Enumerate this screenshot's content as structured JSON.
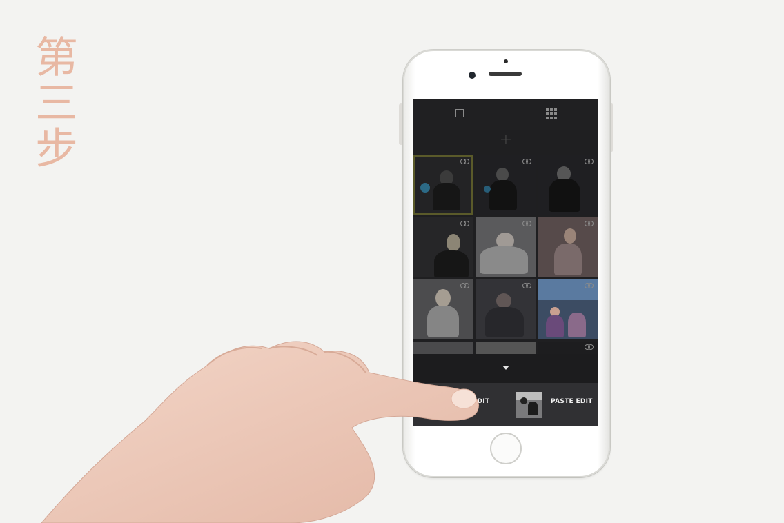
{
  "overlay_text": "第三步",
  "app": {
    "view_toggle": {
      "single_icon": "square-icon",
      "grid_icon": "grid-icon"
    },
    "add_icon_glyph": "+",
    "tiles": [
      {
        "badge": "linked-rings-icon",
        "selected": true
      },
      {
        "badge": "linked-rings-icon"
      },
      {
        "badge": "linked-rings-icon"
      },
      {
        "badge": "linked-rings-icon"
      },
      {
        "badge": "linked-rings-icon"
      },
      {
        "badge": "linked-rings-icon"
      },
      {
        "badge": "linked-rings-icon"
      },
      {
        "badge": "linked-rings-icon"
      },
      {
        "badge": "linked-rings-icon"
      }
    ],
    "copy_edit_label": "EDIT",
    "paste_edit_label": "PASTE EDIT",
    "collapse_icon": "caret-down-icon"
  },
  "colors": {
    "overlay_text": "#e8b8a3",
    "screen_bg": "#1f1f21",
    "action_bar": "#303033"
  }
}
